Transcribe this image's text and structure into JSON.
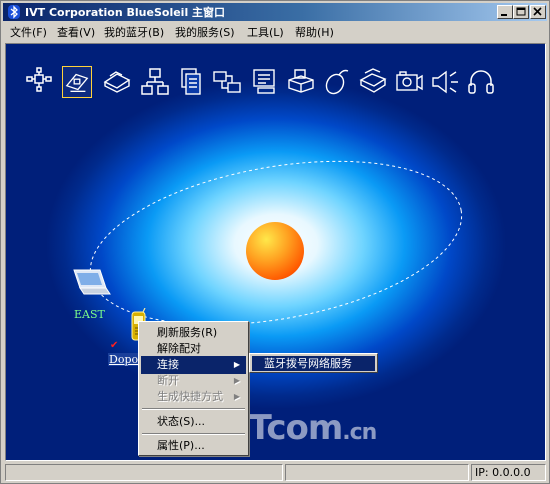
{
  "window": {
    "title": "IVT Corporation BlueSoleil 主窗口"
  },
  "menubar": {
    "items": [
      "文件(F)",
      "查看(V)",
      "我的蓝牙(B)",
      "我的服务(S)",
      "工具(L)",
      "帮助(H)"
    ]
  },
  "services": {
    "icons": [
      "network-service-icon",
      "dialup-service-icon",
      "fax-service-icon",
      "lan-service-icon",
      "file-transfer-icon",
      "sync-icon",
      "object-push-icon",
      "printer-icon",
      "mouse-icon",
      "fax-machine-icon",
      "camera-icon",
      "audio-icon",
      "headset-icon"
    ],
    "selected_index": 1
  },
  "devices": {
    "laptop_label": "EAST",
    "phone_label": "Dopod"
  },
  "context_menu": {
    "items": [
      {
        "label": "刷新服务(R)",
        "state": "normal"
      },
      {
        "label": "解除配对",
        "state": "normal"
      },
      {
        "label": "连接",
        "state": "active",
        "submenu": true
      },
      {
        "label": "断开",
        "state": "disabled",
        "submenu": true
      },
      {
        "label": "生成快捷方式",
        "state": "disabled",
        "submenu": true
      },
      {
        "label": "状态(S)...",
        "state": "normal"
      },
      {
        "label": "属性(P)...",
        "state": "normal"
      }
    ]
  },
  "submenu": {
    "item": "蓝牙拨号网络服务"
  },
  "watermark": {
    "text_main": "iTcom",
    "text_tld": ".cn"
  },
  "statusbar": {
    "left": "",
    "middle": "",
    "ip": "IP: 0.0.0.0"
  },
  "colors": {
    "title_start": "#0a246a",
    "title_end": "#a6caf0",
    "highlight": "#0a246a",
    "laptop_label": "#7CFC8a"
  }
}
